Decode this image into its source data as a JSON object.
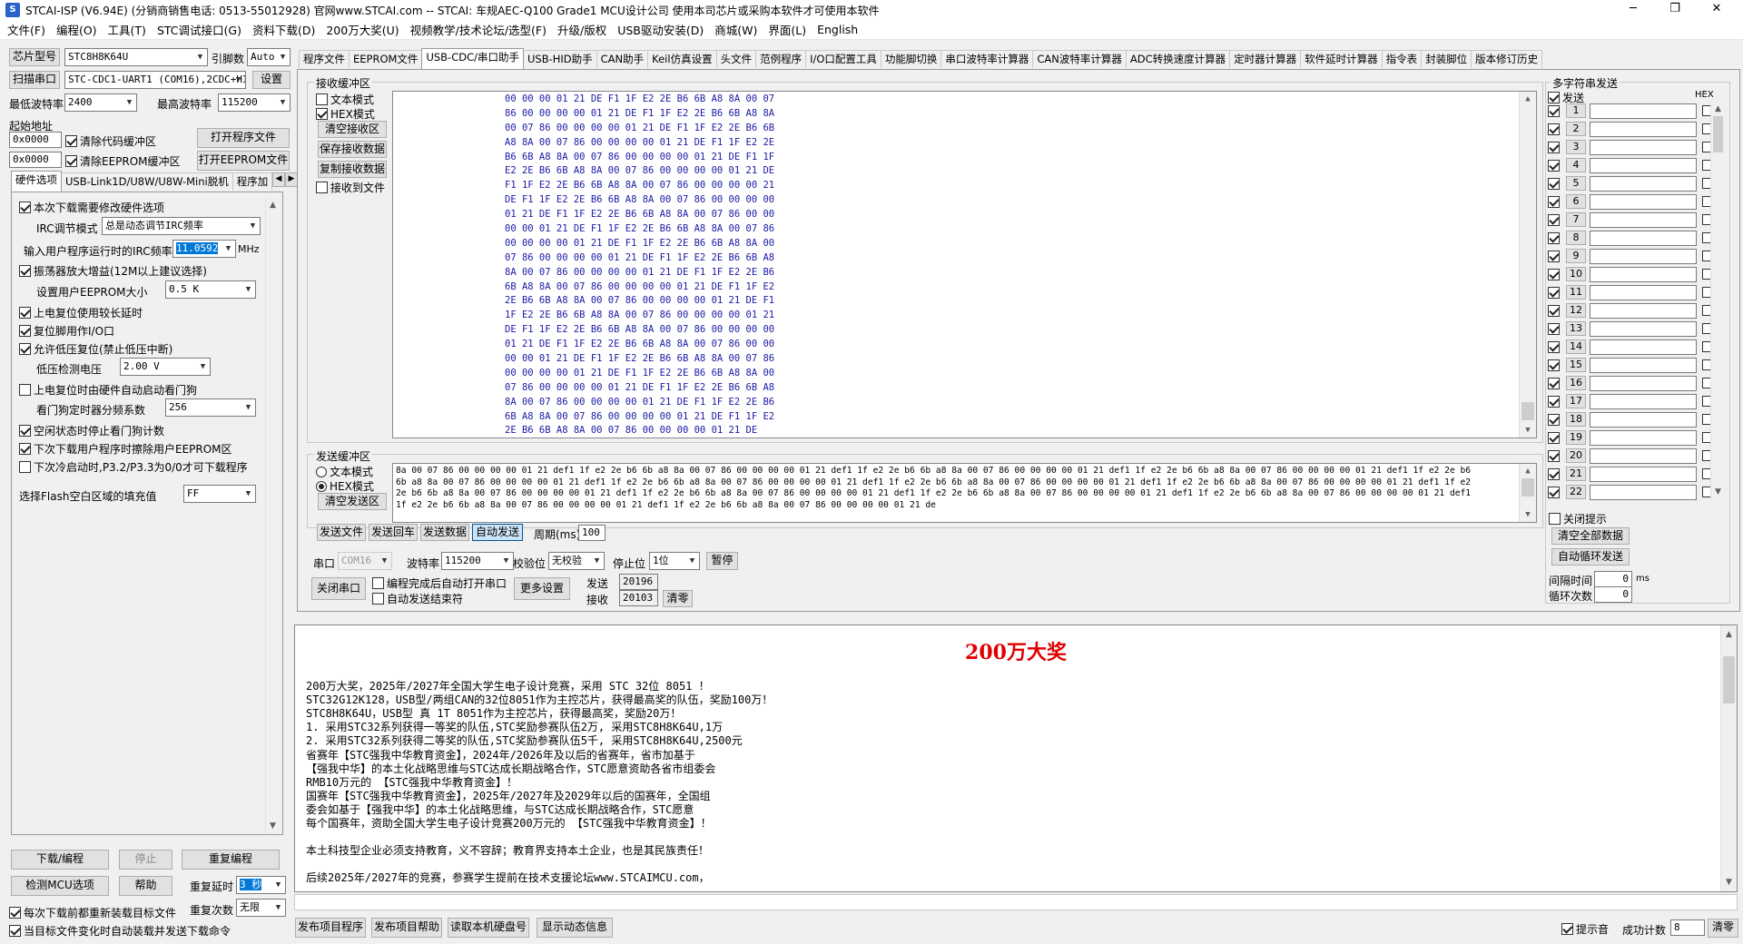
{
  "window": {
    "title": "STCAI-ISP (V6.94E) (分销商销售电话: 0513-55012928) 官网www.STCAI.com  -- STCAI: 车规AEC-Q100 Grade1 MCU设计公司 使用本司芯片或采购本软件才可使用本软件",
    "minimize": "─",
    "maximize": "❐",
    "close": "✕"
  },
  "menu": [
    "文件(F)",
    "编程(O)",
    "工具(T)",
    "STC调试接口(G)",
    "资料下载(D)",
    "200万大奖(U)",
    "视频教学/技术论坛/选型(F)",
    "升级/版权",
    "USB驱动安装(D)",
    "商城(W)",
    "界面(L)",
    "English"
  ],
  "left": {
    "chip_btn": "芯片型号",
    "chip_value": "STC8H8K64U",
    "pins_label": "引脚数",
    "pins_value": "Auto",
    "scan_btn": "扫描串口",
    "port_value": "STC-CDC1-UART1 (COM16),2CDC+HID",
    "settings_btn": "设置",
    "min_baud_label": "最低波特率",
    "min_baud": "2400",
    "max_baud_label": "最高波特率",
    "max_baud": "115200",
    "start_addr_label": "起始地址",
    "addr1": "0x0000",
    "clear_code": "清除代码缓冲区",
    "open_prog": "打开程序文件",
    "addr2": "0x0000",
    "clear_eeprom": "清除EEPROM缓冲区",
    "open_eeprom": "打开EEPROM文件",
    "tabs": [
      "硬件选项",
      "USB-Link1D/U8W/U8W-Mini脱机",
      "程序加"
    ],
    "options": {
      "need_modify": "本次下载需要修改硬件选项",
      "irc_mode_label": "IRC调节模式",
      "irc_mode": "总是动态调节IRC频率",
      "irc_freq_label": "输入用户程序运行时的IRC频率",
      "irc_freq": "11.0592",
      "irc_unit": "MHz",
      "osc_gain": "振荡器放大增益(12M以上建议选择)",
      "eeprom_size_label": "设置用户EEPROM大小",
      "eeprom_size": "0.5 K",
      "por_delay": "上电复位使用较长延时",
      "reset_io": "复位脚用作I/O口",
      "lvd_reset": "允许低压复位(禁止低压中断)",
      "lvd_volt_label": "低压检测电压",
      "lvd_volt": "2.00 V",
      "wdt_auto": "上电复位时由硬件自动启动看门狗",
      "wdt_div_label": "看门狗定时器分频系数",
      "wdt_div": "256",
      "idle_stop_wdt": "空闲状态时停止看门狗计数",
      "erase_eeprom": "下次下载用户程序时擦除用户EEPROM区",
      "cold_boot": "下次冷启动时,P3.2/P3.3为0/0才可下载程序",
      "fill_label": "选择Flash空白区域的填充值",
      "fill_value": "FF"
    },
    "download_btn": "下载/编程",
    "stop_btn": "停止",
    "reprogram_btn": "重复编程",
    "detect_btn": "检测MCU选项",
    "help_btn": "帮助",
    "repeat_delay_label": "重复延时",
    "repeat_delay": "3 秒",
    "reload_each": "每次下载前都重新装载目标文件",
    "repeat_count_label": "重复次数",
    "repeat_count": "无限",
    "auto_reload": "当目标文件变化时自动装载并发送下载命令"
  },
  "main_tabs": [
    "程序文件",
    "EEPROM文件",
    "USB-CDC/串口助手",
    "USB-HID助手",
    "CAN助手",
    "Keil仿真设置",
    "头文件",
    "范例程序",
    "I/O口配置工具",
    "功能脚切换",
    "串口波特率计算器",
    "CAN波特率计算器",
    "ADC转换速度计算器",
    "定时器计算器",
    "软件延时计算器",
    "指令表",
    "封装脚位",
    "版本修订历史"
  ],
  "recv": {
    "title": "接收缓冲区",
    "text_mode": "文本模式",
    "hex_mode": "HEX模式",
    "clear_btn": "清空接收区",
    "save_btn": "保存接收数据",
    "copy_btn": "复制接收数据",
    "to_file": "接收到文件",
    "lines": [
      "00 00 00 01 21 DE F1 1F E2 2E B6 6B A8 8A 00 07",
      "86 00 00 00 00 01 21 DE F1 1F E2 2E B6 6B A8 8A",
      "00 07 86 00 00 00 00 01 21 DE F1 1F E2 2E B6 6B",
      "A8 8A 00 07 86 00 00 00 00 01 21 DE F1 1F E2 2E",
      "B6 6B A8 8A 00 07 86 00 00 00 00 01 21 DE F1 1F",
      "E2 2E B6 6B A8 8A 00 07 86 00 00 00 00 01 21 DE",
      "F1 1F E2 2E B6 6B A8 8A 00 07 86 00 00 00 00 21",
      "DE F1 1F E2 2E B6 6B A8 8A 00 07 86 00 00 00 00",
      "01 21 DE F1 1F E2 2E B6 6B A8 8A 00 07 86 00 00",
      "00 00 01 21 DE F1 1F E2 2E B6 6B A8 8A 00 07 86",
      "00 00 00 00 01 21 DE F1 1F E2 2E B6 6B A8 8A 00",
      "07 86 00 00 00 00 01 21 DE F1 1F E2 2E B6 6B A8",
      "8A 00 07 86 00 00 00 00 01 21 DE F1 1F E2 2E B6",
      "6B A8 8A 00 07 86 00 00 00 00 01 21 DE F1 1F E2",
      "2E B6 6B A8 8A 00 07 86 00 00 00 00 01 21 DE F1",
      "1F E2 2E B6 6B A8 8A 00 07 86 00 00 00 00 01 21",
      "DE F1 1F E2 2E B6 6B A8 8A 00 07 86 00 00 00 00",
      "01 21 DE F1 1F E2 2E B6 6B A8 8A 00 07 86 00 00",
      "00 00 01 21 DE F1 1F E2 2E B6 6B A8 8A 00 07 86",
      "00 00 00 00 01 21 DE F1 1F E2 2E B6 6B A8 8A 00",
      "07 86 00 00 00 00 01 21 DE F1 1F E2 2E B6 6B A8",
      "8A 00 07 86 00 00 00 00 01 21 DE F1 1F E2 2E B6",
      "6B A8 8A 00 07 86 00 00 00 00 01 21 DE F1 1F E2",
      "2E B6 6B A8 8A 00 07 86 00 00 00 00 01 21 DE"
    ]
  },
  "send": {
    "title": "发送缓冲区",
    "text_mode": "文本模式",
    "hex_mode": "HEX模式",
    "clear_btn": "清空发送区",
    "lines": [
      "8a 00 07 86 00 00 00 00 01 21 def1 1f e2 2e b6 6b a8 8a 00 07 86 00 00 00 00 01 21 def1 1f e2 2e b6 6b a8 8a 00 07 86 00 00 00 00 01 21 def1 1f e2 2e b6 6b a8 8a 00 07 86 00 00 00 00 01 21 def1 1f e2 2e b6",
      "6b a8 8a 00 07 86 00 00 00 00 01 21 def1 1f e2 2e b6 6b a8 8a 00 07 86 00 00 00 00 01 21 def1 1f e2 2e b6 6b a8 8a 00 07 86 00 00 00 00 01 21 def1 1f e2 2e b6 6b a8 8a 00 07 86 00 00 00 00 01 21 def1 1f e2",
      "2e b6 6b a8 8a 00 07 86 00 00 00 00 01 21 def1 1f e2 2e b6 6b a8 8a 00 07 86 00 00 00 00 01 21 def1 1f e2 2e b6 6b a8 8a 00 07 86 00 00 00 00 01 21 def1 1f e2 2e b6 6b a8 8a 00 07 86 00 00 00 00 01 21 def1",
      "1f e2 2e b6 6b a8 8a 00 07 86 00 00 00 00 01 21 def1 1f e2 2e b6 6b a8 8a 00 07 86 00 00 00 00 01 21 de"
    ],
    "send_file": "发送文件",
    "send_enter": "发送回车",
    "send_data": "发送数据",
    "auto_send": "自动发送",
    "period_label": "周期(ms)",
    "period": "100"
  },
  "serial": {
    "port_label": "串口",
    "port": "COM16",
    "baud_label": "波特率",
    "baud": "115200",
    "parity_label": "校验位",
    "parity": "无校验",
    "stop_label": "停止位",
    "stop": "1位",
    "pause_btn": "暂停",
    "close_btn": "关闭串口",
    "auto_open": "编程完成后自动打开串口",
    "auto_end": "自动发送结束符",
    "more_btn": "更多设置",
    "sent_label": "发送",
    "sent": "20196",
    "recv_label": "接收",
    "recv": "20103",
    "clear_btn": "清零"
  },
  "multi": {
    "title": "多字符串发送",
    "send_header": "发送",
    "hex_header": "HEX",
    "rows": [
      "1",
      "2",
      "3",
      "4",
      "5",
      "6",
      "7",
      "8",
      "9",
      "10",
      "11",
      "12",
      "13",
      "14",
      "15",
      "16",
      "17",
      "18",
      "19",
      "20",
      "21",
      "22"
    ],
    "close_hint": "关闭提示",
    "clear_all": "清空全部数据",
    "auto_loop": "自动循环发送",
    "interval_label": "间隔时间",
    "interval": "0",
    "interval_unit": "ms",
    "loop_label": "循环次数",
    "loop": "0"
  },
  "info": {
    "title": "200万大奖",
    "lines": [
      "200万大奖，2025年/2027年全国大学生电子设计竞赛，采用 STC 32位 8051 ！",
      "STC32G12K128，USB型/两组CAN的32位8051作为主控芯片，获得最高奖的队伍，奖励100万！",
      "STC8H8K64U，USB型 真 1T 8051作为主控芯片，获得最高奖，奖励20万！",
      "1. 采用STC32系列获得一等奖的队伍,STC奖励参赛队伍2万, 采用STC8H8K64U,1万",
      "2. 采用STC32系列获得二等奖的队伍,STC奖励参赛队伍5千, 采用STC8H8K64U,2500元",
      "省赛年【STC强我中华教育资金】，2024年/2026年及以后的省赛年，省市加基于",
      "【强我中华】的本土化战略思维与STC达成长期战略合作，STC愿意资助各省市组委会",
      "RMB10万元的 【STC强我中华教育资金】！",
      "国赛年【STC强我中华教育资金】，2025年/2027年及2029年以后的国赛年，全国组",
      "委会如基于【强我中华】的本土化战略思维，与STC达成长期战略合作，STC愿意",
      "每个国赛年，资助全国大学生电子设计竞赛200万元的 【STC强我中华教育资金】！",
      "",
      "本土科技型企业必须支持教育，义不容辞；教育界支持本土企业，也是其民族责任！",
      "",
      "后续2025年/2027年的竞赛，参赛学生提前在技术支援论坛www.STCAIMCU.com，"
    ]
  },
  "bottom": {
    "publish_prog": "发布项目程序",
    "publish_help": "发布项目帮助",
    "read_disk": "读取本机硬盘号",
    "show_dynamic": "显示动态信息",
    "hint": "提示音",
    "success_label": "成功计数",
    "success": "8",
    "clear_btn": "清零"
  }
}
